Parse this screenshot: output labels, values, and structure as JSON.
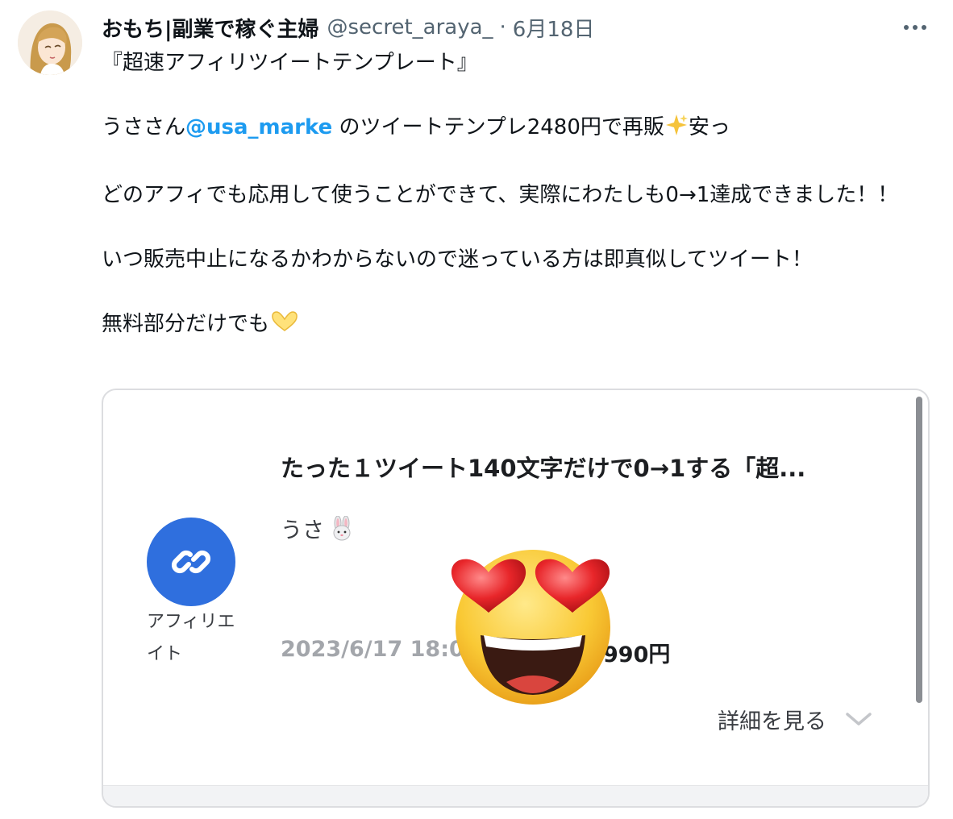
{
  "tweet": {
    "display_name": "おもち|副業で稼ぐ主婦",
    "handle": "@secret_araya_",
    "separator": "·",
    "date": "6月18日",
    "avatar_icon": "user-avatar-illustration"
  },
  "body": {
    "line1": "『超速アフィリツイートテンプレート』",
    "line2_before": "うささん",
    "mention": "@usa_marke",
    "line2_after": " のツイートテンプレ2480円で再販",
    "line2_end": "安っ",
    "line3": "どのアフィでも応用して使うことができて、実際にわたしも0→1達成できました！！",
    "line4": "いつ販売中止になるかわからないので迷っている方は即真似してツイート！",
    "line5": "無料部分だけでも",
    "emoji_sparkles": "sparkles-icon",
    "emoji_hands": "heart-hands-icon"
  },
  "card": {
    "title": "たった１ツイート140文字だけで0→1する「超...",
    "author": "うさ",
    "author_emoji": "rabbit-face-icon",
    "link_label": "アフィリエイト",
    "date": "2023/6/17 18:0",
    "price": "990円",
    "details_label": "詳細を見る",
    "link_icon": "link-chain-icon",
    "overlay_emoji": "heart-eyes-face-icon"
  },
  "colors": {
    "mention": "#1d9bf0",
    "link_circle": "#2f6fde",
    "muted": "#536471"
  }
}
